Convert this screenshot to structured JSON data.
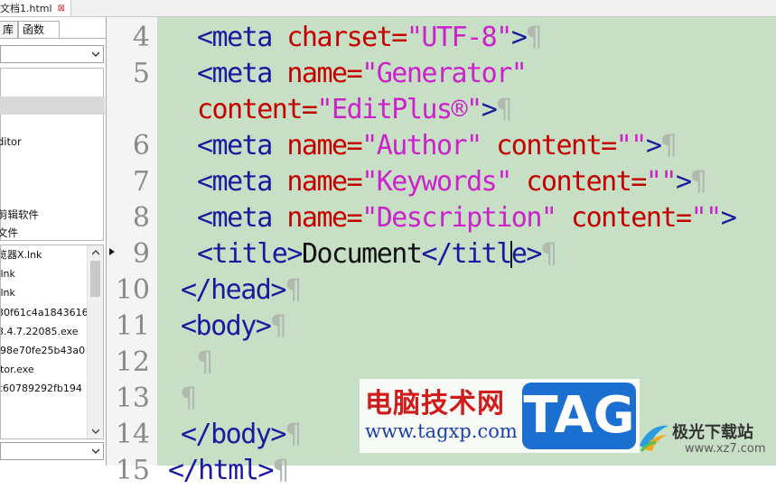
{
  "tab": {
    "title": "文档1.html",
    "close": "⊠"
  },
  "panel": {
    "tabs": [
      "库",
      "函数"
    ],
    "dirs": [
      {
        "label": "",
        "selected": false
      },
      {
        "label": "",
        "selected": true
      },
      {
        "label": "ditor",
        "selected": false
      },
      {
        "label": "",
        "selected": false
      },
      {
        "label": "",
        "selected": false
      },
      {
        "label": "剪辑软件",
        "selected": false
      },
      {
        "label": "文件",
        "selected": false
      }
    ],
    "files": [
      "览器X.lnk",
      ".lnk",
      ".lnk",
      "30f61c4a1843616",
      "3.4.7.22085.exe",
      "l98e70fe25b43a0",
      "itor.exe",
      "c60789292fb194",
      "."
    ]
  },
  "editor": {
    "caret_line": 9,
    "lines": [
      {
        "num": "4",
        "indent": 2,
        "tokens": [
          [
            "k",
            "<meta "
          ],
          [
            "a",
            "charset="
          ],
          [
            "v",
            "\"UTF-8\""
          ],
          [
            "k",
            ">"
          ],
          [
            "p",
            "¶"
          ]
        ]
      },
      {
        "num": "5",
        "indent": 2,
        "tokens": [
          [
            "k",
            "<meta "
          ],
          [
            "a",
            "name="
          ],
          [
            "v",
            "\"Generator\""
          ]
        ]
      },
      {
        "num": "",
        "indent": 2,
        "tokens": [
          [
            "a",
            "content="
          ],
          [
            "v",
            "\"EditPlus®\""
          ],
          [
            "k",
            ">"
          ],
          [
            "p",
            "¶"
          ]
        ]
      },
      {
        "num": "6",
        "indent": 2,
        "tokens": [
          [
            "k",
            "<meta "
          ],
          [
            "a",
            "name="
          ],
          [
            "v",
            "\"Author\" "
          ],
          [
            "a",
            "content="
          ],
          [
            "v",
            "\"\""
          ],
          [
            "k",
            ">"
          ],
          [
            "p",
            "¶"
          ]
        ]
      },
      {
        "num": "7",
        "indent": 2,
        "tokens": [
          [
            "k",
            "<meta "
          ],
          [
            "a",
            "name="
          ],
          [
            "v",
            "\"Keywords\" "
          ],
          [
            "a",
            "content="
          ],
          [
            "v",
            "\"\""
          ],
          [
            "k",
            ">"
          ],
          [
            "p",
            "¶"
          ]
        ]
      },
      {
        "num": "8",
        "indent": 2,
        "tokens": [
          [
            "k",
            "<meta "
          ],
          [
            "a",
            "name="
          ],
          [
            "v",
            "\"Description\" "
          ],
          [
            "a",
            "content="
          ],
          [
            "v",
            "\"\""
          ],
          [
            "k",
            ">"
          ]
        ]
      },
      {
        "num": "9",
        "indent": 2,
        "tokens": [
          [
            "k",
            "<title>"
          ],
          [
            "t",
            "Document"
          ],
          [
            "k",
            "</titl"
          ],
          [
            "caret",
            ""
          ],
          [
            "k",
            "e>"
          ],
          [
            "p",
            "¶"
          ]
        ]
      },
      {
        "num": "10",
        "indent": 1,
        "tokens": [
          [
            "k",
            "</head>"
          ],
          [
            "p",
            "¶"
          ]
        ]
      },
      {
        "num": "11",
        "indent": 1,
        "tokens": [
          [
            "k",
            "<body>"
          ],
          [
            "p",
            "¶"
          ]
        ]
      },
      {
        "num": "12",
        "indent": 2,
        "tokens": [
          [
            "p",
            "¶"
          ]
        ]
      },
      {
        "num": "13",
        "indent": 1,
        "tokens": [
          [
            "p",
            "¶"
          ]
        ]
      },
      {
        "num": "14",
        "indent": 1,
        "tokens": [
          [
            "k",
            "</body>"
          ],
          [
            "p",
            "¶"
          ]
        ]
      },
      {
        "num": "15",
        "indent": 0,
        "tokens": [
          [
            "k",
            "</html>"
          ],
          [
            "p",
            "¶"
          ]
        ]
      }
    ]
  },
  "watermark": {
    "site_name": "电脑技术网",
    "site_url": "www.tagxp.com",
    "badge": "TAG",
    "brand2_name": "极光下载站",
    "brand2_url": "www.xz7.com"
  },
  "colors": {
    "editor_bg": "#c7dfc4",
    "tag": "#1a1aa0",
    "attribute": "#c40000",
    "value": "#cc22cc",
    "text": "#111111",
    "pilcrow": "#b0b8b0",
    "line_number": "#8a8a8a"
  }
}
